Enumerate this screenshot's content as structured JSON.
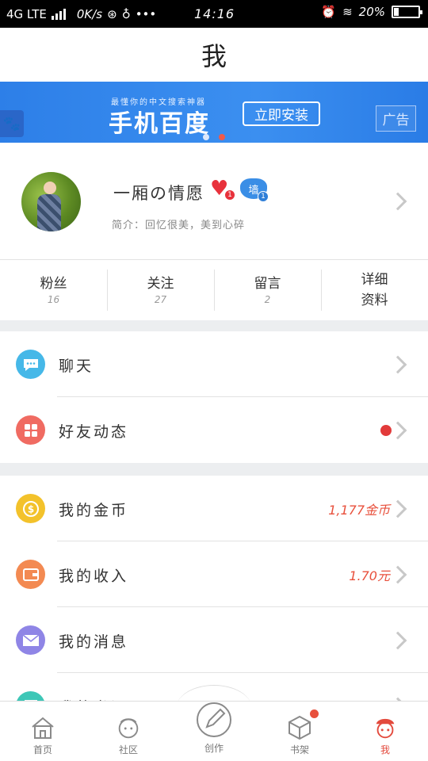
{
  "status_bar": {
    "network": "4G LTE",
    "speed": "0K/s",
    "time": "14:16",
    "battery_text": "20%",
    "battery_level": 0.2
  },
  "header": {
    "title": "我"
  },
  "banner": {
    "slogan": "最懂你的中文搜索神器",
    "brand": "手机百度",
    "install_label": "立即安装",
    "ad_label": "广告",
    "slides": 2,
    "active_slide": 2
  },
  "profile": {
    "username": "一厢の情愿",
    "heart_badge_count": "1",
    "cat_badge_char": "墙",
    "cat_badge_count": "1",
    "bio": "简介：回忆很美，美到心碎"
  },
  "stats": [
    {
      "label": "粉丝",
      "value": "16"
    },
    {
      "label": "关注",
      "value": "27"
    },
    {
      "label": "留言",
      "value": "2"
    },
    {
      "label_line1": "详细",
      "label_line2": "资料"
    }
  ],
  "menu_group1": [
    {
      "label": "聊天",
      "icon": "chat-bubble-icon",
      "color": "#46b8e8"
    },
    {
      "label": "好友动态",
      "icon": "grid-icon",
      "color": "#f06b62"
    }
  ],
  "menu_group2": [
    {
      "label": "我的金币",
      "icon": "coin-icon",
      "color": "#f3c22b",
      "value": "1,177金币"
    },
    {
      "label": "我的收入",
      "icon": "wallet-icon",
      "color": "#f38a52",
      "value": "1.70元"
    },
    {
      "label": "我的消息",
      "icon": "envelope-icon",
      "color": "#8f85e6"
    },
    {
      "label": "我的书评",
      "icon": "book-icon",
      "color": "#3ec7b7"
    }
  ],
  "tabs": [
    {
      "label": "首页",
      "icon": "home-icon"
    },
    {
      "label": "社区",
      "icon": "community-icon"
    },
    {
      "label": "创作",
      "icon": "pen-icon"
    },
    {
      "label": "书架",
      "icon": "box-icon"
    },
    {
      "label": "我",
      "icon": "me-icon"
    }
  ],
  "colors": {
    "accent": "#e8503c",
    "banner_blue": "#3b8ff0",
    "page_bg": "#eceef0"
  }
}
